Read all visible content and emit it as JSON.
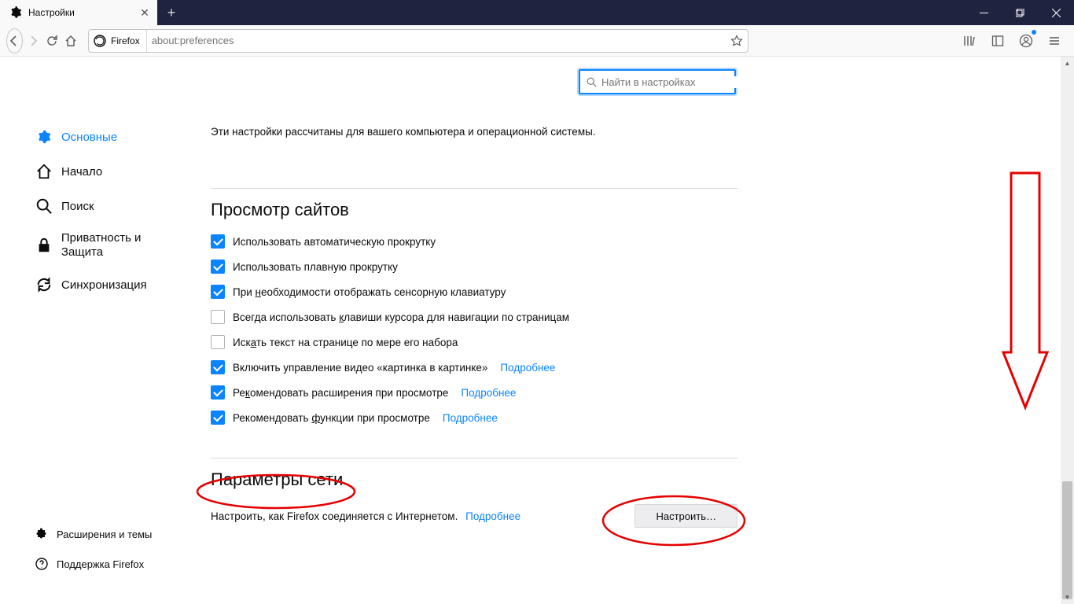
{
  "window": {
    "tab_title": "Настройки",
    "new_tab": "+"
  },
  "urlbar": {
    "identity_label": "Firefox",
    "url": "about:preferences"
  },
  "search": {
    "placeholder": "Найти в настройках"
  },
  "sidebar": {
    "items": [
      {
        "label": "Основные"
      },
      {
        "label": "Начало"
      },
      {
        "label": "Поиск"
      },
      {
        "label": "Приватность и Защита"
      },
      {
        "label": "Синхронизация"
      }
    ]
  },
  "helpers": {
    "extensions": "Расширения и темы",
    "support": "Поддержка Firefox"
  },
  "main": {
    "intro": "Эти настройки рассчитаны для вашего компьютера и операционной системы.",
    "browsing_title": "Просмотр сайтов",
    "opts": [
      {
        "label": "Использовать автоматическую прокрутку",
        "checked": true
      },
      {
        "label": "Использовать плавную прокрутку",
        "checked": true
      },
      {
        "label_html": "При <u>н</u>еобходимости отображать сенсорную клавиатуру",
        "checked": true
      },
      {
        "label_html": "Всегда использовать <u>к</u>лавиши курсора для навигации по страницам",
        "checked": false
      },
      {
        "label_html": "Иск<u>а</u>ть текст на странице по мере его набора",
        "checked": false
      },
      {
        "label": "Включить управление видео «картинка в картинке»",
        "checked": true,
        "more": "Подробнее"
      },
      {
        "label_html": "Ре<u>к</u>омендовать расширения при просмотре",
        "checked": true,
        "more": "Подробнее"
      },
      {
        "label_html": "Рекомендовать <u>ф</u>ункции при просмотре",
        "checked": true,
        "more": "Подробнее"
      }
    ],
    "network_title": "Параметры сети",
    "network_desc": "Настроить, как Firefox соединяется с Интернетом.",
    "network_more": "Подробнее",
    "network_btn": "Настроить…"
  }
}
